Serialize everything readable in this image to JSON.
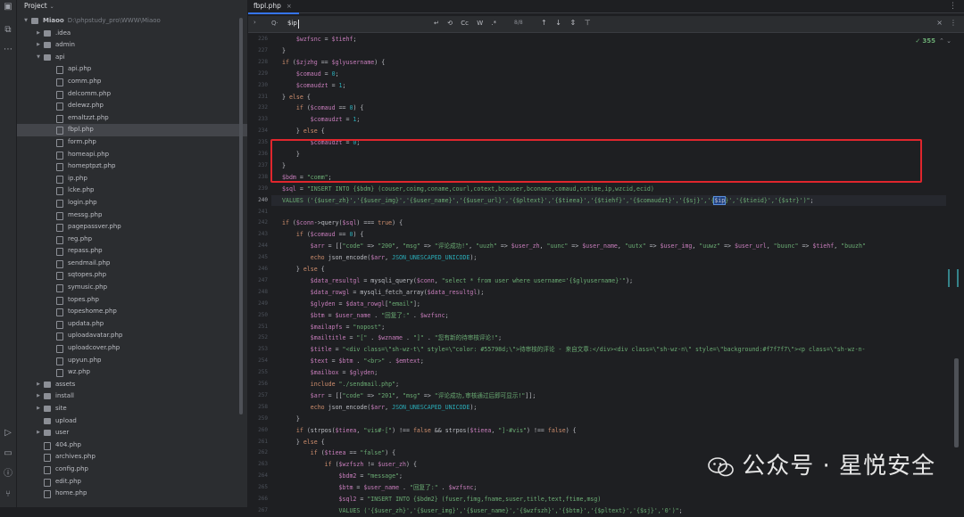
{
  "project": {
    "title": "Project",
    "tree": [
      {
        "label": "Miaoo",
        "path": "D:\\phpstudy_pro\\WWW\\Miaoo",
        "type": "folder",
        "depth": 0,
        "open": true,
        "bold": true
      },
      {
        "label": ".idea",
        "type": "folder",
        "depth": 1,
        "open": false
      },
      {
        "label": "admin",
        "type": "folder",
        "depth": 1,
        "open": false
      },
      {
        "label": "api",
        "type": "folder",
        "depth": 1,
        "open": true
      },
      {
        "label": "api.php",
        "type": "php",
        "depth": 2
      },
      {
        "label": "comm.php",
        "type": "php",
        "depth": 2
      },
      {
        "label": "delcomm.php",
        "type": "php",
        "depth": 2
      },
      {
        "label": "delewz.php",
        "type": "php",
        "depth": 2
      },
      {
        "label": "emaltzzt.php",
        "type": "php",
        "depth": 2
      },
      {
        "label": "fbpl.php",
        "type": "php",
        "depth": 2,
        "selected": true
      },
      {
        "label": "form.php",
        "type": "php",
        "depth": 2
      },
      {
        "label": "homeapi.php",
        "type": "php",
        "depth": 2
      },
      {
        "label": "homeptpzt.php",
        "type": "php",
        "depth": 2
      },
      {
        "label": "ip.php",
        "type": "php",
        "depth": 2
      },
      {
        "label": "lcke.php",
        "type": "php",
        "depth": 2
      },
      {
        "label": "login.php",
        "type": "php",
        "depth": 2
      },
      {
        "label": "messg.php",
        "type": "php",
        "depth": 2
      },
      {
        "label": "pagepassver.php",
        "type": "php",
        "depth": 2
      },
      {
        "label": "reg.php",
        "type": "php",
        "depth": 2
      },
      {
        "label": "repass.php",
        "type": "php",
        "depth": 2
      },
      {
        "label": "sendmail.php",
        "type": "php",
        "depth": 2
      },
      {
        "label": "sqtopes.php",
        "type": "php",
        "depth": 2
      },
      {
        "label": "symusic.php",
        "type": "php",
        "depth": 2
      },
      {
        "label": "topes.php",
        "type": "php",
        "depth": 2
      },
      {
        "label": "topeshome.php",
        "type": "php",
        "depth": 2
      },
      {
        "label": "updata.php",
        "type": "php",
        "depth": 2
      },
      {
        "label": "uploadavatar.php",
        "type": "php",
        "depth": 2
      },
      {
        "label": "uploadcover.php",
        "type": "php",
        "depth": 2
      },
      {
        "label": "upyun.php",
        "type": "php",
        "depth": 2
      },
      {
        "label": "wz.php",
        "type": "php",
        "depth": 2
      },
      {
        "label": "assets",
        "type": "folder",
        "depth": 1,
        "open": false
      },
      {
        "label": "install",
        "type": "folder",
        "depth": 1,
        "open": false
      },
      {
        "label": "site",
        "type": "folder",
        "depth": 1,
        "open": false
      },
      {
        "label": "upload",
        "type": "folder",
        "depth": 1,
        "noarrow": true
      },
      {
        "label": "user",
        "type": "folder",
        "depth": 1,
        "open": false
      },
      {
        "label": "404.php",
        "type": "php",
        "depth": 1
      },
      {
        "label": "archives.php",
        "type": "php",
        "depth": 1
      },
      {
        "label": "config.php",
        "type": "php",
        "depth": 1
      },
      {
        "label": "edit.php",
        "type": "php",
        "depth": 1
      },
      {
        "label": "home.php",
        "type": "php",
        "depth": 1
      }
    ]
  },
  "editor": {
    "tab_label": "fbpl.php",
    "find": {
      "query": "$ip",
      "case_label": "Cc",
      "word_label": "W",
      "regex_label": ".*",
      "count": "8/8"
    },
    "inspections": "355",
    "current_line": 240,
    "lines": [
      {
        "n": 226,
        "html": "    <span class='var'>$wzfsnc</span> = <span class='var'>$tiehf</span>;"
      },
      {
        "n": 227,
        "html": "}"
      },
      {
        "n": 228,
        "html": "<span class='kw'>if</span> (<span class='var'>$zjzhg</span> == <span class='var'>$glyusername</span>) {"
      },
      {
        "n": 229,
        "html": "    <span class='var'>$comaud</span> = <span class='num'>0</span>;"
      },
      {
        "n": 230,
        "html": "    <span class='var'>$comaudzt</span> = <span class='num'>1</span>;"
      },
      {
        "n": 231,
        "html": "} <span class='kw'>else</span> {"
      },
      {
        "n": 232,
        "html": "    <span class='kw'>if</span> (<span class='var'>$comaud</span> == <span class='num'>0</span>) {"
      },
      {
        "n": 233,
        "html": "        <span class='var'>$comaudzt</span> = <span class='num'>1</span>;"
      },
      {
        "n": 234,
        "html": "    } <span class='kw'>else</span> {"
      },
      {
        "n": 235,
        "html": "        <span class='var'>$comaudzt</span> = <span class='num'>0</span>;"
      },
      {
        "n": 236,
        "html": "    }"
      },
      {
        "n": 237,
        "html": "}"
      },
      {
        "n": 238,
        "html": "<span class='var'>$bdm</span> = <span class='str'>\"comm\"</span>;"
      },
      {
        "n": 239,
        "html": "<span class='var'>$sql</span> = <span class='str'>\"INSERT INTO {$bdm} (couser,coimg,coname,courl,cotext,bcouser,bconame,comaud,cotime,ip,wzcid,ecid)</span>"
      },
      {
        "n": 240,
        "html": "<span class='str'>VALUES ('{$user_zh}','{$user_img}','{$user_name}','{$user_url}','{$pltext}','{$tieea}','{$tiehf}','{$comaudzt}','{$sj}','{</span><span class='hl'>$ip</span><span class='str'>}','{$tieid}','{$str}')\"</span>;"
      },
      {
        "n": 241,
        "html": ""
      },
      {
        "n": 242,
        "html": "<span class='kw'>if</span> (<span class='var'>$conn</span>-&gt;query(<span class='var'>$sql</span>) === <span class='kw'>true</span>) {"
      },
      {
        "n": 243,
        "html": "    <span class='kw'>if</span> (<span class='var'>$comaud</span> == <span class='num'>0</span>) {"
      },
      {
        "n": 244,
        "html": "        <span class='var'>$arr</span> = [[<span class='str'>\"code\"</span> =&gt; <span class='str'>\"200\"</span>, <span class='str'>\"msg\"</span> =&gt; <span class='str'>\"评论成功!\"</span>, <span class='str'>\"uuzh\"</span> =&gt; <span class='var'>$user_zh</span>, <span class='str'>\"uunc\"</span> =&gt; <span class='var'>$user_name</span>, <span class='str'>\"uutx\"</span> =&gt; <span class='var'>$user_img</span>, <span class='str'>\"uuwz\"</span> =&gt; <span class='var'>$user_url</span>, <span class='str'>\"buunc\"</span> =&gt; <span class='var'>$tiehf</span>, <span class='str'>\"buuzh\"</span>"
      },
      {
        "n": 245,
        "html": "        <span class='kw'>echo</span> json_encode(<span class='var'>$arr</span>, <span class='num'>JSON_UNESCAPED_UNICODE</span>);"
      },
      {
        "n": 246,
        "html": "    } <span class='kw'>else</span> {"
      },
      {
        "n": 247,
        "html": "        <span class='var'>$data_resultgl</span> = mysqli_query(<span class='var'>$conn</span>, <span class='str'>\"select * from user where username='{$glyusername}'\"</span>);"
      },
      {
        "n": 248,
        "html": "        <span class='var'>$data_rowgl</span> = mysqli_fetch_array(<span class='var'>$data_resultgl</span>);"
      },
      {
        "n": 249,
        "html": "        <span class='var'>$glyden</span> = <span class='var'>$data_rowgl</span>[<span class='str'>\"email\"</span>];"
      },
      {
        "n": 250,
        "html": "        <span class='var'>$btm</span> = <span class='var'>$user_name</span> . <span class='str'>\"回复了:\"</span> . <span class='var'>$wzfsnc</span>;"
      },
      {
        "n": 251,
        "html": "        <span class='var'>$mailapfs</span> = <span class='str'>\"nopost\"</span>;"
      },
      {
        "n": 252,
        "html": "        <span class='var'>$mailtitle</span> = <span class='str'>\"[\"</span> . <span class='var'>$wzname</span> . <span class='str'>\"]\"</span> . <span class='str'>\"您有新的待审核评论!\"</span>;"
      },
      {
        "n": 253,
        "html": "        <span class='var'>$title</span> = <span class='str'>\"&lt;div class=\\\"sh-wz-t\\\" style=\\\"color: #55798d;\\\"&gt;待审核的评论 - 来自文章:&lt;/div&gt;&lt;div class=\\\"sh-wz-n\\\" style=\\\"background:#f7f7f7\\\"&gt;&lt;p class=\\\"sh-wz-n-</span>"
      },
      {
        "n": 254,
        "html": "        <span class='var'>$text</span> = <span class='var'>$btm</span> . <span class='str'>\"&lt;br&gt;\"</span> . <span class='var'>$emtext</span>;"
      },
      {
        "n": 255,
        "html": "        <span class='var'>$mailbox</span> = <span class='var'>$glyden</span>;"
      },
      {
        "n": 256,
        "html": "        <span class='kw'>include</span> <span class='str'>\"./sendmail.php\"</span>;"
      },
      {
        "n": 257,
        "html": "        <span class='var'>$arr</span> = [[<span class='str'>\"code\"</span> =&gt; <span class='str'>\"201\"</span>, <span class='str'>\"msg\"</span> =&gt; <span class='str'>\"评论成功,审核通过后即可显示!\"</span>]];"
      },
      {
        "n": 258,
        "html": "        <span class='kw'>echo</span> json_encode(<span class='var'>$arr</span>, <span class='num'>JSON_UNESCAPED_UNICODE</span>);"
      },
      {
        "n": 259,
        "html": "    }"
      },
      {
        "n": 260,
        "html": "    <span class='kw'>if</span> (strpos(<span class='var'>$tieea</span>, <span class='str'>\"vis#-[\"</span>) !== <span class='kw'>false</span> &amp;&amp; strpos(<span class='var'>$tieea</span>, <span class='str'>\"]-#vis\"</span>) !== <span class='kw'>false</span>) {"
      },
      {
        "n": 261,
        "html": "    } <span class='kw'>else</span> {"
      },
      {
        "n": 262,
        "html": "        <span class='kw'>if</span> (<span class='var'>$tieea</span> == <span class='str'>\"false\"</span>) {"
      },
      {
        "n": 263,
        "html": "            <span class='kw'>if</span> (<span class='var'>$wzfszh</span> != <span class='var'>$user_zh</span>) {"
      },
      {
        "n": 264,
        "html": "                <span class='var'>$bdm2</span> = <span class='str'>\"message\"</span>;"
      },
      {
        "n": 265,
        "html": "                <span class='var'>$btm</span> = <span class='var'>$user_name</span> . <span class='str'>\"回复了:\"</span> . <span class='var'>$wzfsnc</span>;"
      },
      {
        "n": 266,
        "html": "                <span class='var'>$sql2</span> = <span class='str'>\"INSERT INTO {$bdm2} (fuser,fimg,fname,suser,title,text,ftime,msg)</span>"
      },
      {
        "n": 267,
        "html": "                <span class='str'>VALUES ('{$user_zh}','{$user_img}','{$user_name}','{$wzfszh}','{$btm}','{$pltext}','{$sj}','0')\"</span>;"
      }
    ]
  },
  "watermark": {
    "text": "公众号 · 星悦安全"
  }
}
